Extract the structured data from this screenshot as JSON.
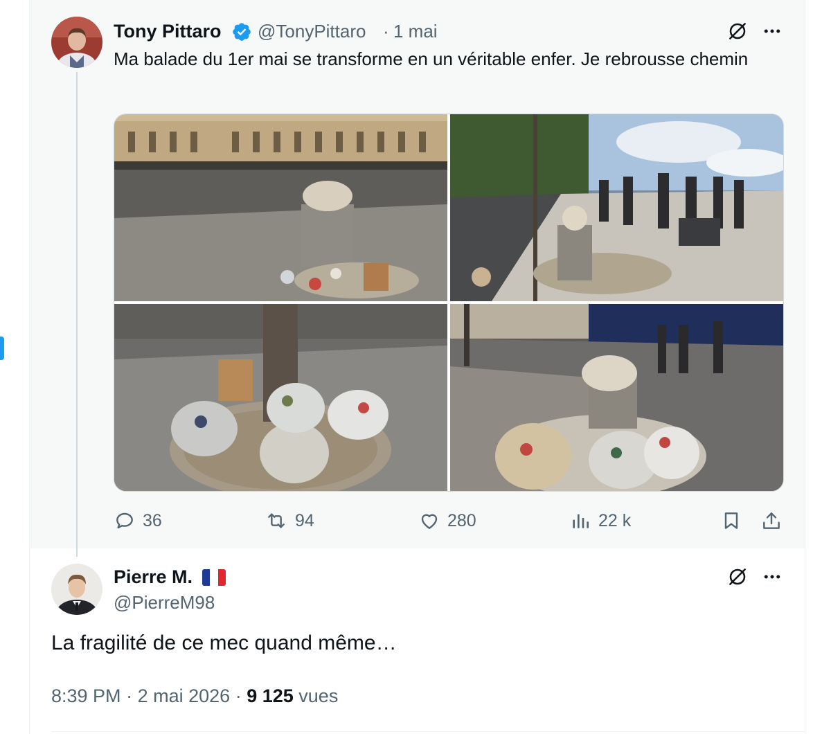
{
  "quoted_tweet": {
    "author_name": "Tony Pittaro",
    "handle": "@TonyPittaro",
    "separator": "·",
    "time": "1 mai",
    "text": "Ma balade du 1er mai se transforme en un véritable enfer. Je rebrousse chemin",
    "photos": [
      "photo-1",
      "photo-2",
      "photo-3",
      "photo-4"
    ],
    "actions": {
      "replies": "36",
      "reposts": "94",
      "likes": "280",
      "views": "22 k"
    }
  },
  "reply_tweet": {
    "author_name": "Pierre M.",
    "flag": "🇫🇷",
    "handle": "@PierreM98",
    "text": "La fragilité de ce mec quand même…",
    "time": "8:39 PM",
    "date": "2 mai 2026",
    "views_count": "9 125",
    "views_label": "vues"
  },
  "icons": {
    "verified": "verified-badge-icon",
    "grok": "grok-icon",
    "more": "more-icon",
    "reply": "reply-icon",
    "repost": "repost-icon",
    "like": "like-icon",
    "views": "views-icon",
    "bookmark": "bookmark-icon",
    "share": "share-icon"
  },
  "colors": {
    "accent": "#1d9bf0",
    "secondary_text": "#536471",
    "quoted_background": "#f7f9f9"
  }
}
